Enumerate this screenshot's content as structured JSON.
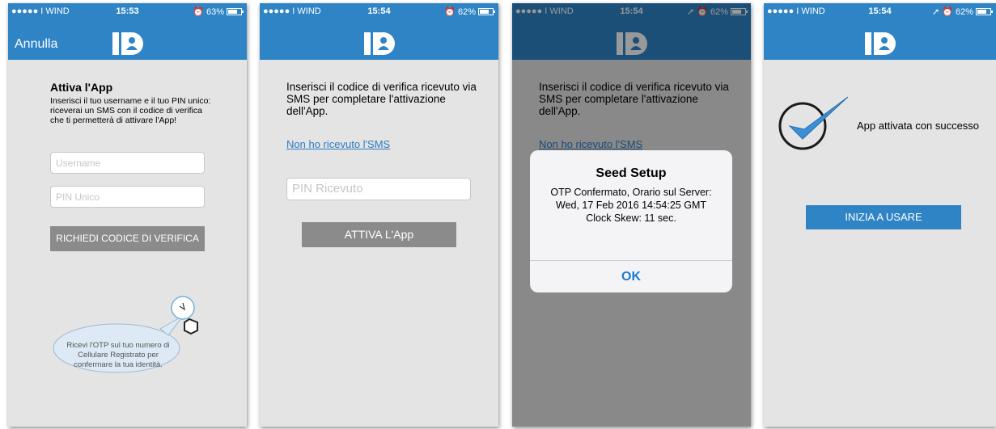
{
  "colors": {
    "brand_blue": "#2f84c6",
    "link_blue": "#2b7bc4",
    "button_gray": "#8b8b8b",
    "screen_bg": "#e4e4e4"
  },
  "logo_text": "ID",
  "screens": [
    {
      "status": {
        "carrier": "●●●●● I WIND",
        "time": "15:53",
        "battery": "63%",
        "battery_level": 0.63
      },
      "nav_left": "Annulla",
      "title": "Attiva l'App",
      "description": "Inserisci il tuo username e il tuo PIN unico: riceverai un SMS con il codice di verifica che ti permetterà di attivare l'App!",
      "username_placeholder": "Username",
      "pin_placeholder": "PIN Unico",
      "request_button": "RICHIEDI CODICE DI VERIFICA",
      "bubble_text": "Ricevi l'OTP sul tuo numero di Cellulare Registrato per confermare la tua identità."
    },
    {
      "status": {
        "carrier": "●●●●● I WIND",
        "time": "15:54",
        "battery": "62%",
        "battery_level": 0.62
      },
      "intro": "Inserisci il codice di verifica ricevuto via SMS per completare l'attivazione dell'App.",
      "link": "Non ho ricevuto l'SMS",
      "pin_placeholder": "PIN Ricevuto",
      "activate_button": "ATTIVA L'App"
    },
    {
      "status": {
        "carrier": "●●●●● I WIND",
        "time": "15:54",
        "battery": "62%",
        "battery_level": 0.62
      },
      "intro": "Inserisci il codice di verifica ricevuto via SMS per completare l'attivazione dell'App.",
      "link": "Non ho ricevuto l'SMS",
      "alert": {
        "title": "Seed Setup",
        "line1": "OTP Confermato, Orario sul Server:",
        "line2": "Wed, 17 Feb 2016 14:54:25 GMT",
        "line3": "Clock Skew: 11 sec.",
        "ok": "OK"
      }
    },
    {
      "status": {
        "carrier": "●●●●● I WIND",
        "time": "15:54",
        "battery": "62%",
        "battery_level": 0.62
      },
      "success_text": "App attivata con successo",
      "start_button": "INIZIA A USARE"
    }
  ]
}
